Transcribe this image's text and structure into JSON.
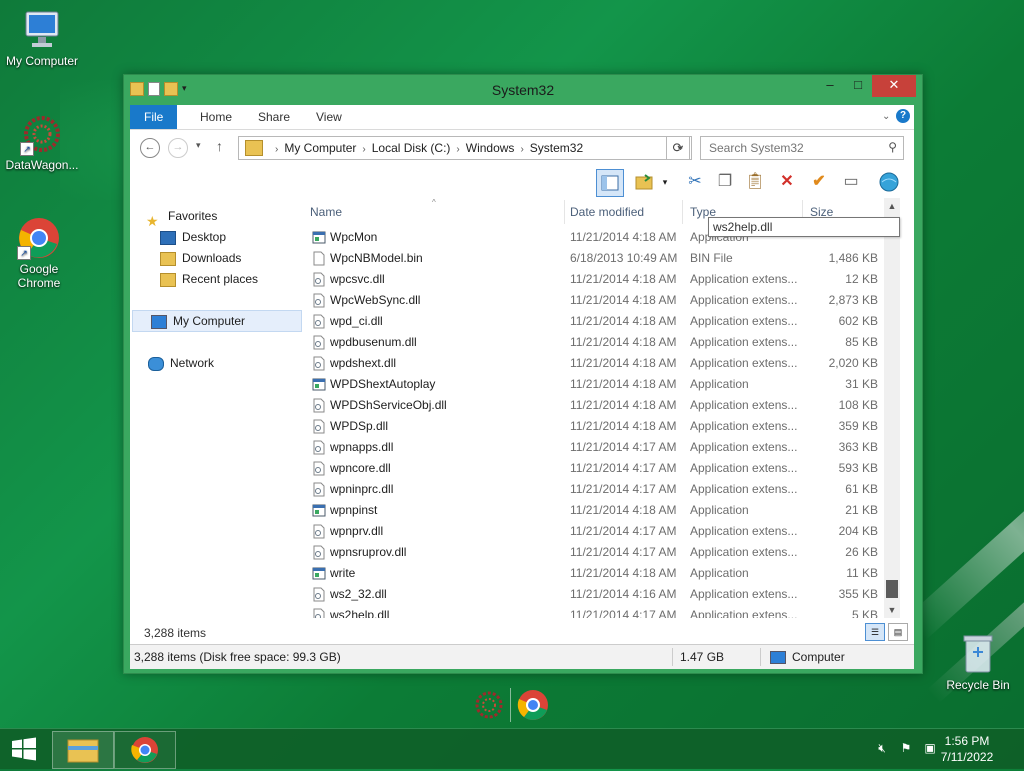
{
  "desktop": {
    "icons": [
      {
        "label": "My Computer"
      },
      {
        "label": "DataWagon..."
      },
      {
        "label": "Google Chrome"
      }
    ],
    "recycle_bin": "Recycle Bin"
  },
  "window": {
    "title": "System32",
    "ribbon_tabs": [
      "File",
      "Home",
      "Share",
      "View"
    ],
    "breadcrumbs": [
      "My Computer",
      "Local Disk (C:)",
      "Windows",
      "System32"
    ],
    "search_placeholder": "Search System32",
    "navpane": {
      "favorites": "Favorites",
      "favorites_items": [
        "Desktop",
        "Downloads",
        "Recent places"
      ],
      "my_computer": "My Computer",
      "network": "Network"
    },
    "columns": {
      "name": "Name",
      "date": "Date modified",
      "type": "Type",
      "size": "Size"
    },
    "tooltip": "ws2help.dll",
    "files": [
      {
        "name": "WpcMon",
        "date": "11/21/2014 4:18 AM",
        "type": "Application",
        "size": "",
        "icon": "app-icon"
      },
      {
        "name": "WpcNBModel.bin",
        "date": "6/18/2013 10:49 AM",
        "type": "BIN File",
        "size": "1,486 KB",
        "icon": "file-icon"
      },
      {
        "name": "wpcsvc.dll",
        "date": "11/21/2014 4:18 AM",
        "type": "Application extens...",
        "size": "12 KB",
        "icon": "dll-icon"
      },
      {
        "name": "WpcWebSync.dll",
        "date": "11/21/2014 4:18 AM",
        "type": "Application extens...",
        "size": "2,873 KB",
        "icon": "dll-icon"
      },
      {
        "name": "wpd_ci.dll",
        "date": "11/21/2014 4:18 AM",
        "type": "Application extens...",
        "size": "602 KB",
        "icon": "dll-icon"
      },
      {
        "name": "wpdbusenum.dll",
        "date": "11/21/2014 4:18 AM",
        "type": "Application extens...",
        "size": "85 KB",
        "icon": "dll-icon"
      },
      {
        "name": "wpdshext.dll",
        "date": "11/21/2014 4:18 AM",
        "type": "Application extens...",
        "size": "2,020 KB",
        "icon": "dll-icon"
      },
      {
        "name": "WPDShextAutoplay",
        "date": "11/21/2014 4:18 AM",
        "type": "Application",
        "size": "31 KB",
        "icon": "app-icon"
      },
      {
        "name": "WPDShServiceObj.dll",
        "date": "11/21/2014 4:18 AM",
        "type": "Application extens...",
        "size": "108 KB",
        "icon": "dll-icon"
      },
      {
        "name": "WPDSp.dll",
        "date": "11/21/2014 4:18 AM",
        "type": "Application extens...",
        "size": "359 KB",
        "icon": "dll-icon"
      },
      {
        "name": "wpnapps.dll",
        "date": "11/21/2014 4:17 AM",
        "type": "Application extens...",
        "size": "363 KB",
        "icon": "dll-icon"
      },
      {
        "name": "wpncore.dll",
        "date": "11/21/2014 4:17 AM",
        "type": "Application extens...",
        "size": "593 KB",
        "icon": "dll-icon"
      },
      {
        "name": "wpninprc.dll",
        "date": "11/21/2014 4:17 AM",
        "type": "Application extens...",
        "size": "61 KB",
        "icon": "dll-icon"
      },
      {
        "name": "wpnpinst",
        "date": "11/21/2014 4:18 AM",
        "type": "Application",
        "size": "21 KB",
        "icon": "app-icon"
      },
      {
        "name": "wpnprv.dll",
        "date": "11/21/2014 4:17 AM",
        "type": "Application extens...",
        "size": "204 KB",
        "icon": "dll-icon"
      },
      {
        "name": "wpnsruprov.dll",
        "date": "11/21/2014 4:17 AM",
        "type": "Application extens...",
        "size": "26 KB",
        "icon": "dll-icon"
      },
      {
        "name": "write",
        "date": "11/21/2014 4:18 AM",
        "type": "Application",
        "size": "11 KB",
        "icon": "app-icon"
      },
      {
        "name": "ws2_32.dll",
        "date": "11/21/2014 4:16 AM",
        "type": "Application extens...",
        "size": "355 KB",
        "icon": "dll-icon"
      },
      {
        "name": "ws2help.dll",
        "date": "11/21/2014 4:17 AM",
        "type": "Application extens...",
        "size": "5 KB",
        "icon": "dll-icon"
      }
    ],
    "item_count": "3,288 items",
    "status": {
      "summary": "3,288 items (Disk free space: 99.3 GB)",
      "size": "1.47 GB",
      "location": "Computer"
    }
  },
  "taskbar": {
    "time": "1:56 PM",
    "date": "7/11/2022"
  },
  "colors": {
    "accent": "#1979ca",
    "window_frame": "#3aa860",
    "close": "#c7413a"
  }
}
